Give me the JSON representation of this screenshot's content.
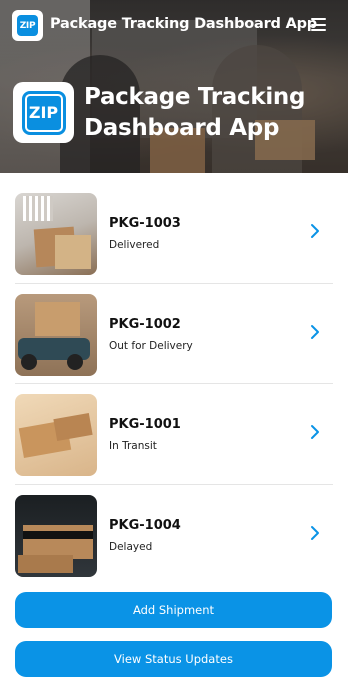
{
  "app": {
    "name": "Package Tracking Dashboard App",
    "logo_text": "ZIP"
  },
  "header": {
    "title": "Package Tracking Dashboard App"
  },
  "colors": {
    "accent": "#0a93e6",
    "text_primary": "#111111",
    "divider": "#e5e5e5"
  },
  "icons": {
    "menu": "hamburger-menu-icon",
    "row_action": "chevron-right-icon"
  },
  "packages": [
    {
      "id": "PKG-1003",
      "status": "Delivered"
    },
    {
      "id": "PKG-1002",
      "status": "Out for Delivery"
    },
    {
      "id": "PKG-1001",
      "status": "In Transit"
    },
    {
      "id": "PKG-1004",
      "status": "Delayed"
    }
  ],
  "actions": {
    "add_shipment": "Add Shipment",
    "view_status_updates": "View Status Updates"
  }
}
